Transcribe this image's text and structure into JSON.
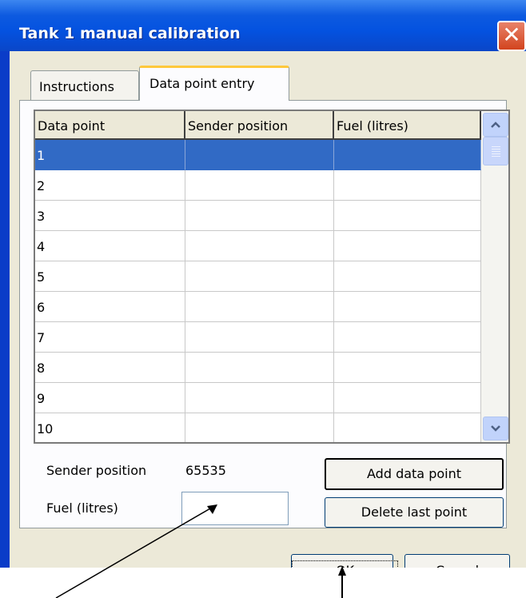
{
  "window": {
    "title": "Tank 1 manual calibration",
    "close_glyph": "✕"
  },
  "tabs": [
    {
      "label": "Instructions",
      "active": false
    },
    {
      "label": "Data point entry",
      "active": true
    }
  ],
  "grid": {
    "headers": [
      "Data point",
      "Sender position",
      "Fuel (litres)"
    ],
    "rows": [
      {
        "cells": [
          "1",
          "",
          ""
        ],
        "selected": true
      },
      {
        "cells": [
          "2",
          "",
          ""
        ]
      },
      {
        "cells": [
          "3",
          "",
          ""
        ]
      },
      {
        "cells": [
          "4",
          "",
          ""
        ]
      },
      {
        "cells": [
          "5",
          "",
          ""
        ]
      },
      {
        "cells": [
          "6",
          "",
          ""
        ]
      },
      {
        "cells": [
          "7",
          "",
          ""
        ]
      },
      {
        "cells": [
          "8",
          "",
          ""
        ]
      },
      {
        "cells": [
          "9",
          "",
          ""
        ]
      },
      {
        "cells": [
          "10",
          "",
          ""
        ]
      }
    ]
  },
  "form": {
    "sender_label": "Sender position",
    "sender_value": "65535",
    "fuel_label": "Fuel (litres)",
    "fuel_value": ""
  },
  "buttons": {
    "add": "Add data point",
    "delete": "Delete last point",
    "ok": "OK",
    "cancel": "Cancel"
  },
  "colors": {
    "selection": "#316ac5",
    "titlebar": "#0452e0",
    "dialog_bg": "#ece9d8"
  }
}
